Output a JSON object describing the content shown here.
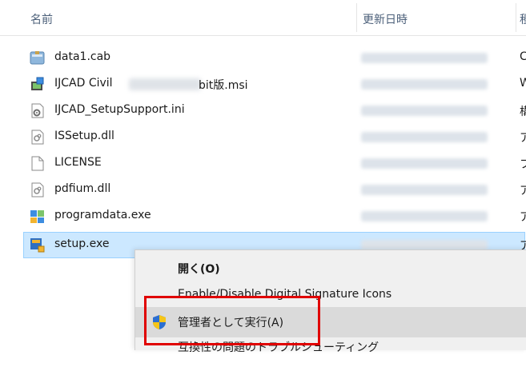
{
  "columns": {
    "name": "名前",
    "date": "更新日時",
    "type": "種"
  },
  "files": [
    {
      "name": "data1.cab",
      "type": "C",
      "icon": "cab-archive-icon",
      "selected": false
    },
    {
      "name_prefix": "IJCAD Civil",
      "name_suffix": "bit版.msi",
      "type": "W",
      "icon": "installer-package-icon",
      "selected": false
    },
    {
      "name": "IJCAD_SetupSupport.ini",
      "type": "構",
      "icon": "config-settings-icon",
      "selected": false
    },
    {
      "name": "ISSetup.dll",
      "type": "ア",
      "icon": "dll-file-icon",
      "selected": false
    },
    {
      "name": "LICENSE",
      "type": "フ",
      "icon": "blank-file-icon",
      "selected": false
    },
    {
      "name": "pdfium.dll",
      "type": "ア",
      "icon": "dll-file-icon",
      "selected": false
    },
    {
      "name": "programdata.exe",
      "type": "ア",
      "icon": "exe-program-icon",
      "selected": false
    },
    {
      "name": "setup.exe",
      "type": "ア",
      "icon": "exe-program-icon",
      "selected": true
    }
  ],
  "context_menu": {
    "items": [
      {
        "label": "開く(O)",
        "bold": true,
        "icon": null
      },
      {
        "label": "Enable/Disable Digital Signature Icons",
        "bold": false,
        "icon": null
      },
      {
        "label": "管理者として実行(A)",
        "bold": false,
        "icon": "uac-shield-icon",
        "hover": true
      },
      {
        "label": "互換性の問題のトラブルシューティング",
        "bold": false,
        "icon": null
      }
    ]
  },
  "colors": {
    "selection": "#cce8ff",
    "highlight_frame": "#e00000",
    "menu_bg": "#f0f0f0"
  }
}
